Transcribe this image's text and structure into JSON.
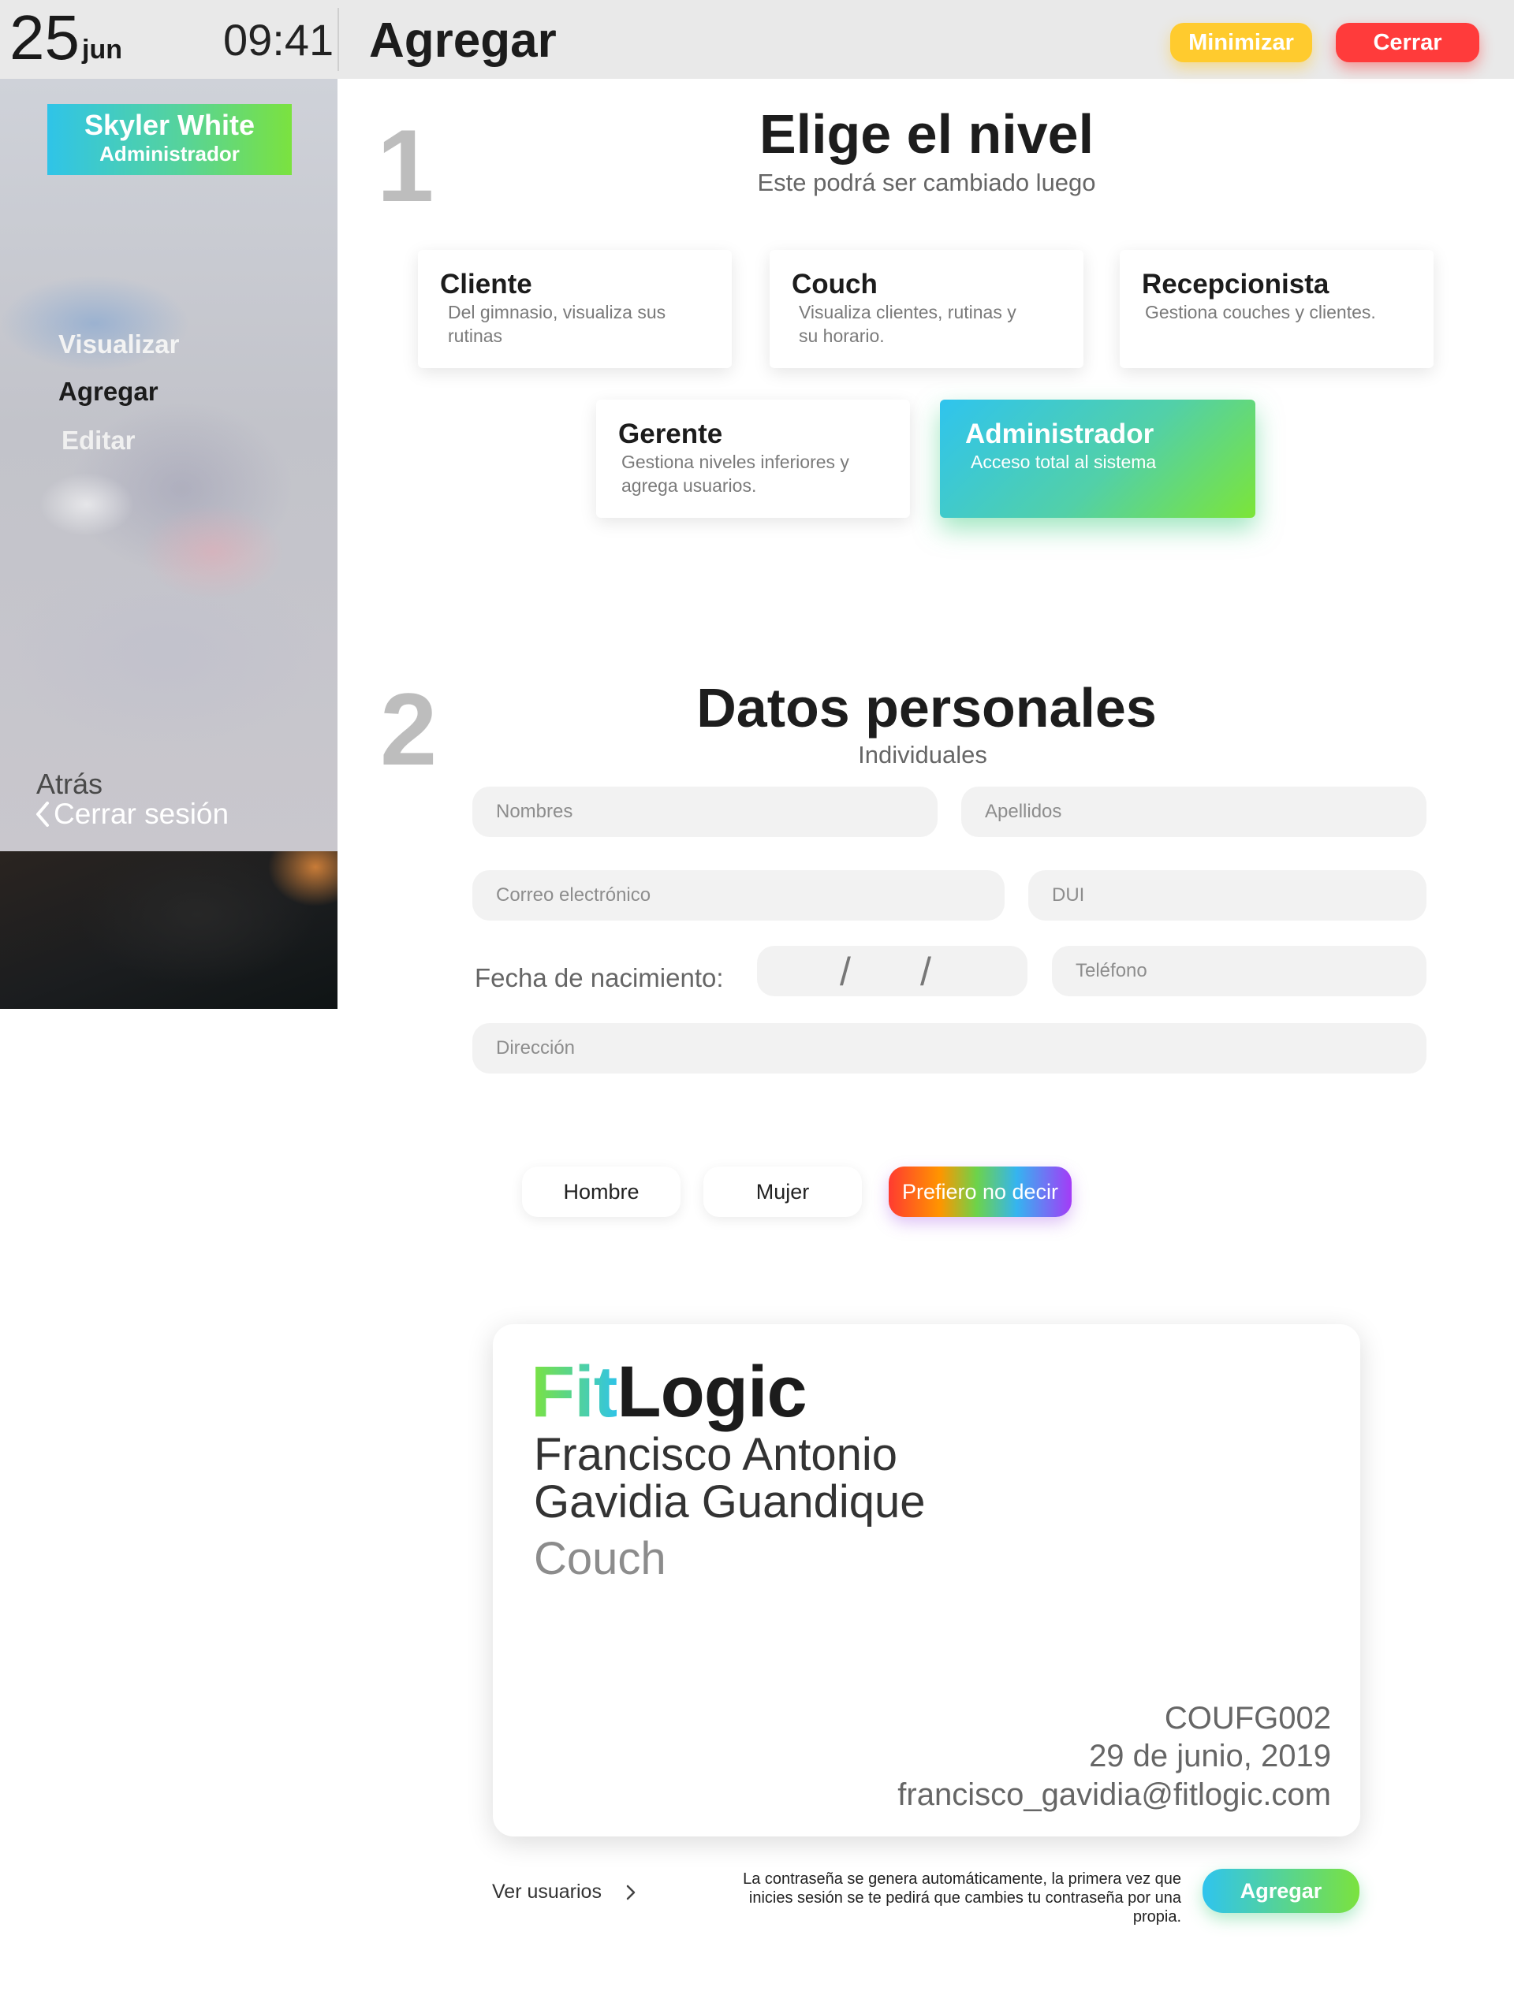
{
  "topbar": {
    "day": "25",
    "month": "jun",
    "time": "09:41",
    "title": "Agregar",
    "minimize_label": "Minimizar",
    "close_label": "Cerrar"
  },
  "sidebar": {
    "user_name": "Skyler White",
    "user_role": "Administrador",
    "items": [
      {
        "label": "Visualizar"
      },
      {
        "label": "Agregar"
      },
      {
        "label": "Editar"
      }
    ],
    "back_label": "Atrás",
    "logout_label": "Cerrar sesión"
  },
  "step1": {
    "number": "1",
    "title": "Elige el nivel",
    "subtitle": "Este podrá ser cambiado luego",
    "levels": [
      {
        "name": "Cliente",
        "desc": "Del gimnasio, visualiza sus rutinas"
      },
      {
        "name": "Couch",
        "desc": "Visualiza clientes, rutinas y su horario."
      },
      {
        "name": "Recepcionista",
        "desc": "Gestiona couches y clientes."
      },
      {
        "name": "Gerente",
        "desc": "Gestiona niveles inferiores y agrega usuarios."
      },
      {
        "name": "Administrador",
        "desc": "Acceso total al sistema"
      }
    ],
    "selected": "Administrador"
  },
  "step2": {
    "number": "2",
    "title": "Datos personales",
    "subtitle": "Individuales",
    "placeholders": {
      "nombres": "Nombres",
      "apellidos": "Apellidos",
      "correo": "Correo electrónico",
      "dui": "DUI",
      "telefono": "Teléfono",
      "direccion": "Dirección"
    },
    "dob_label": "Fecha de nacimiento:",
    "dob_separator": "/",
    "genders": [
      "Hombre",
      "Mujer",
      "Prefiero no decir"
    ],
    "selected_gender": "Prefiero no decir"
  },
  "id_card": {
    "brand_fit": "Fit",
    "brand_logic": "Logic",
    "name_line1": "Francisco Antonio",
    "name_line2": "Gavidia Guandique",
    "level": "Couch",
    "code": "COUFG002",
    "date": "29 de junio, 2019",
    "email": "francisco_gavidia@fitlogic.com"
  },
  "footer": {
    "view_users_label": "Ver usuarios",
    "password_note": "La contraseña se genera automáticamente, la primera vez que inicies sesión se te pedirá que cambies tu contraseña por una propia.",
    "add_label": "Agregar"
  },
  "colors": {
    "accent_gradient_start": "#2fc4ee",
    "accent_gradient_end": "#7be23e",
    "minimize": "#ffcb2e",
    "close": "#ff3b3b"
  }
}
